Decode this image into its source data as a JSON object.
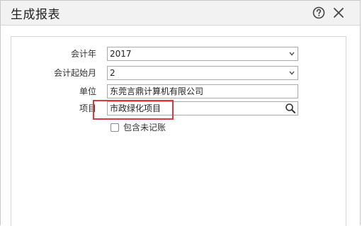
{
  "dialog": {
    "title": "生成报表",
    "help_icon": "help-circle-icon",
    "close_icon": "close-icon"
  },
  "form": {
    "fiscal_year": {
      "label": "会计年",
      "value": "2017"
    },
    "start_month": {
      "label": "会计起始月",
      "value": "2"
    },
    "unit": {
      "label": "单位",
      "value": "东莞言鼎计算机有限公司"
    },
    "project": {
      "label": "项目",
      "value": "市政绿化项目",
      "icon": "search-icon"
    },
    "include_unposted": {
      "label": "包含未记账",
      "checked": false
    }
  },
  "colors": {
    "highlight": "#d9393f"
  }
}
